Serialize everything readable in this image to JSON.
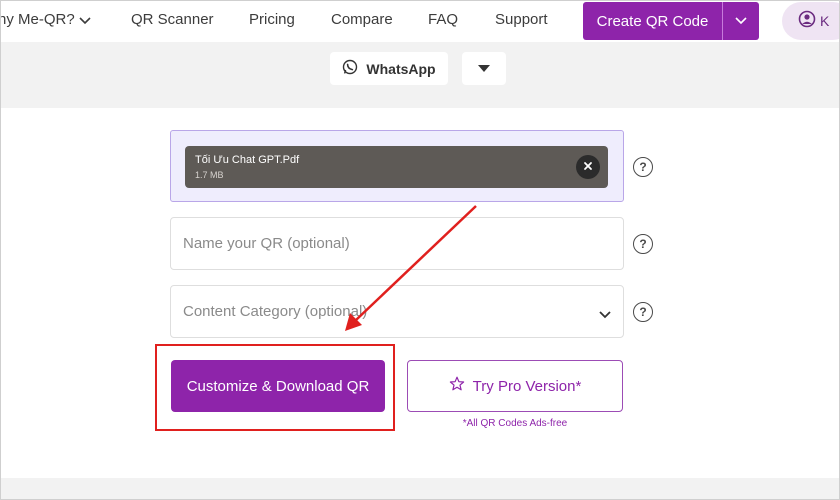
{
  "nav": {
    "why_label": "hy Me-QR?",
    "scanner_label": "QR Scanner",
    "pricing_label": "Pricing",
    "compare_label": "Compare",
    "faq_label": "FAQ",
    "support_label": "Support",
    "create_label": "Create QR Code",
    "account_initial": "K"
  },
  "type_selector": {
    "whatsapp_label": "WhatsApp"
  },
  "upload": {
    "file_name": "Tối Ưu Chat GPT.Pdf",
    "file_size": "1.7 MB"
  },
  "form": {
    "name_placeholder": "Name your QR (optional)",
    "category_placeholder": "Content Category (optional)",
    "help_glyph": "?"
  },
  "actions": {
    "primary_label": "Customize & Download QR",
    "pro_label": "Try Pro Version*",
    "pro_note": "*All QR Codes Ads-free"
  },
  "colors": {
    "brand_purple": "#8e24aa",
    "annotation_red": "#e0201e",
    "upload_bg": "#efedfd"
  },
  "icons": {
    "whatsapp": "whatsapp-icon",
    "remove": "close-icon",
    "help": "question-circle-icon",
    "account": "user-circle-icon",
    "pro": "star-outline-icon"
  }
}
